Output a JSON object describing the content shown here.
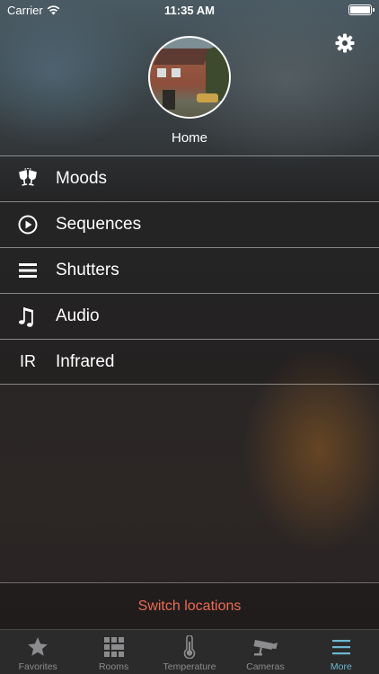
{
  "status_bar": {
    "carrier": "Carrier",
    "time": "11:35 AM"
  },
  "header": {
    "location_name": "Home",
    "settings_icon": "gear-icon"
  },
  "menu": {
    "items": [
      {
        "label": "Moods",
        "icon": "champagne-glasses-icon"
      },
      {
        "label": "Sequences",
        "icon": "play-circle-icon"
      },
      {
        "label": "Shutters",
        "icon": "shutter-lines-icon"
      },
      {
        "label": "Audio",
        "icon": "music-note-icon"
      },
      {
        "label": "Infrared",
        "icon": "ir-icon",
        "icon_text": "IR"
      }
    ]
  },
  "switch_locations": {
    "label": "Switch locations",
    "color": "#ec6a55"
  },
  "tab_bar": {
    "active_color": "#6cb8d0",
    "inactive_color": "#8c8c8e",
    "tabs": [
      {
        "label": "Favorites",
        "icon": "star-icon"
      },
      {
        "label": "Rooms",
        "icon": "grid-icon"
      },
      {
        "label": "Temperature",
        "icon": "thermometer-icon"
      },
      {
        "label": "Cameras",
        "icon": "camera-icon"
      },
      {
        "label": "More",
        "icon": "menu-icon",
        "active": true
      }
    ]
  }
}
